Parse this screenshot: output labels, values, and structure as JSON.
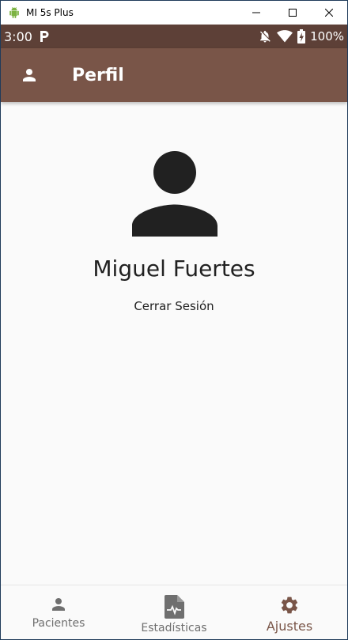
{
  "window": {
    "title": "MI 5s Plus"
  },
  "statusbar": {
    "time": "3:00",
    "battery": "100%"
  },
  "appbar": {
    "title": "Perfil"
  },
  "profile": {
    "name": "Miguel Fuertes",
    "logout_label": "Cerrar Sesión"
  },
  "bottom_nav": {
    "items": [
      {
        "label": "Pacientes",
        "icon": "person-icon"
      },
      {
        "label": "Estadísticas",
        "icon": "chart-document-icon"
      },
      {
        "label": "Ajustes",
        "icon": "gear-icon"
      }
    ],
    "active_index": 2
  },
  "colors": {
    "statusbar": "#5d4037",
    "appbar": "#795548",
    "accent": "#795548",
    "text": "#212121"
  }
}
